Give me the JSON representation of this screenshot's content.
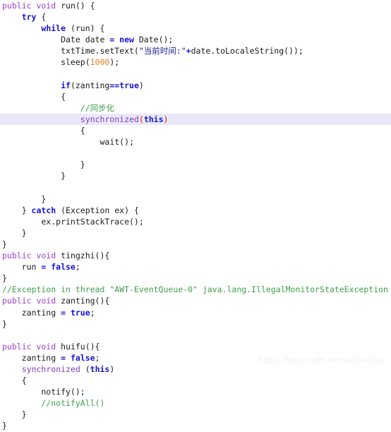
{
  "document": {
    "kind": "source-code-screenshot",
    "language": "Java",
    "watermark": "https://blog.csdn.net/xindashou"
  },
  "code": {
    "lines": [
      {
        "highlighted": false,
        "tokens": [
          {
            "t": "public void ",
            "c": "mod"
          },
          {
            "t": "run() {",
            "c": "plain"
          }
        ]
      },
      {
        "highlighted": false,
        "tokens": [
          {
            "t": "    ",
            "c": "plain"
          },
          {
            "t": "try",
            "c": "kw"
          },
          {
            "t": " {",
            "c": "plain"
          }
        ]
      },
      {
        "highlighted": false,
        "tokens": [
          {
            "t": "        ",
            "c": "plain"
          },
          {
            "t": "while",
            "c": "kw"
          },
          {
            "t": " (run) {",
            "c": "plain"
          }
        ]
      },
      {
        "highlighted": false,
        "tokens": [
          {
            "t": "            Date date ",
            "c": "plain"
          },
          {
            "t": "= new",
            "c": "kw"
          },
          {
            "t": " Date();",
            "c": "plain"
          }
        ]
      },
      {
        "highlighted": false,
        "tokens": [
          {
            "t": "            txtTime.setText(",
            "c": "plain"
          },
          {
            "t": "\"当前时间:\"",
            "c": "str"
          },
          {
            "t": "+",
            "c": "kw"
          },
          {
            "t": "date.toLocaleString());",
            "c": "plain"
          }
        ]
      },
      {
        "highlighted": false,
        "tokens": [
          {
            "t": "            sleep(",
            "c": "plain"
          },
          {
            "t": "1000",
            "c": "num"
          },
          {
            "t": ");",
            "c": "plain"
          }
        ]
      },
      {
        "highlighted": false,
        "tokens": [
          {
            "t": "",
            "c": "plain"
          }
        ]
      },
      {
        "highlighted": false,
        "tokens": [
          {
            "t": "            ",
            "c": "plain"
          },
          {
            "t": "if",
            "c": "kw"
          },
          {
            "t": "(zanting",
            "c": "plain"
          },
          {
            "t": "==true",
            "c": "kw"
          },
          {
            "t": ")",
            "c": "plain"
          }
        ]
      },
      {
        "highlighted": false,
        "tokens": [
          {
            "t": "            {",
            "c": "plain"
          }
        ]
      },
      {
        "highlighted": false,
        "tokens": [
          {
            "t": "                ",
            "c": "plain"
          },
          {
            "t": "//同步化",
            "c": "comment"
          }
        ]
      },
      {
        "highlighted": true,
        "tokens": [
          {
            "t": "                ",
            "c": "plain"
          },
          {
            "t": "synchronized",
            "c": "sync"
          },
          {
            "t": "(",
            "c": "paren-red"
          },
          {
            "t": "this",
            "c": "this"
          },
          {
            "t": ")",
            "c": "paren-red"
          }
        ]
      },
      {
        "highlighted": false,
        "tokens": [
          {
            "t": "                {",
            "c": "plain"
          }
        ]
      },
      {
        "highlighted": false,
        "tokens": [
          {
            "t": "                    wait();",
            "c": "plain"
          }
        ]
      },
      {
        "highlighted": false,
        "tokens": [
          {
            "t": "",
            "c": "plain"
          }
        ]
      },
      {
        "highlighted": false,
        "tokens": [
          {
            "t": "                }",
            "c": "plain"
          }
        ]
      },
      {
        "highlighted": false,
        "tokens": [
          {
            "t": "            }",
            "c": "plain"
          }
        ]
      },
      {
        "highlighted": false,
        "tokens": [
          {
            "t": "",
            "c": "plain"
          }
        ]
      },
      {
        "highlighted": false,
        "tokens": [
          {
            "t": "        }",
            "c": "plain"
          }
        ]
      },
      {
        "highlighted": false,
        "tokens": [
          {
            "t": "    } ",
            "c": "plain"
          },
          {
            "t": "catch",
            "c": "kw"
          },
          {
            "t": " (Exception ex) {",
            "c": "plain"
          }
        ]
      },
      {
        "highlighted": false,
        "tokens": [
          {
            "t": "        ex.printStackTrace();",
            "c": "plain"
          }
        ]
      },
      {
        "highlighted": false,
        "tokens": [
          {
            "t": "    }",
            "c": "plain"
          }
        ]
      },
      {
        "highlighted": false,
        "tokens": [
          {
            "t": "}",
            "c": "plain"
          }
        ]
      },
      {
        "highlighted": false,
        "tokens": [
          {
            "t": "public void ",
            "c": "mod"
          },
          {
            "t": "tingzhi(){",
            "c": "plain"
          }
        ]
      },
      {
        "highlighted": false,
        "tokens": [
          {
            "t": "    run ",
            "c": "plain"
          },
          {
            "t": "= false",
            "c": "kw"
          },
          {
            "t": ";",
            "c": "plain"
          }
        ]
      },
      {
        "highlighted": false,
        "tokens": [
          {
            "t": "}",
            "c": "plain"
          }
        ]
      },
      {
        "highlighted": false,
        "tokens": [
          {
            "t": "//Exception in thread \"AWT-EventQueue-0\" java.lang.IllegalMonitorStateException",
            "c": "comment"
          }
        ]
      },
      {
        "highlighted": false,
        "tokens": [
          {
            "t": "public void ",
            "c": "mod"
          },
          {
            "t": "zanting(){",
            "c": "plain"
          }
        ]
      },
      {
        "highlighted": false,
        "tokens": [
          {
            "t": "    zanting ",
            "c": "plain"
          },
          {
            "t": "= true",
            "c": "kw"
          },
          {
            "t": ";",
            "c": "plain"
          }
        ]
      },
      {
        "highlighted": false,
        "tokens": [
          {
            "t": "}",
            "c": "plain"
          }
        ]
      },
      {
        "highlighted": false,
        "tokens": [
          {
            "t": "",
            "c": "plain"
          }
        ]
      },
      {
        "highlighted": false,
        "tokens": [
          {
            "t": "public void ",
            "c": "mod"
          },
          {
            "t": "huifu(){",
            "c": "plain"
          }
        ]
      },
      {
        "highlighted": false,
        "tokens": [
          {
            "t": "    zanting ",
            "c": "plain"
          },
          {
            "t": "= false",
            "c": "kw"
          },
          {
            "t": ";",
            "c": "plain"
          }
        ]
      },
      {
        "highlighted": false,
        "tokens": [
          {
            "t": "    ",
            "c": "plain"
          },
          {
            "t": "synchronized",
            "c": "sync"
          },
          {
            "t": " (",
            "c": "plain"
          },
          {
            "t": "this",
            "c": "this"
          },
          {
            "t": ")",
            "c": "plain"
          }
        ]
      },
      {
        "highlighted": false,
        "tokens": [
          {
            "t": "    {",
            "c": "plain"
          }
        ]
      },
      {
        "highlighted": false,
        "tokens": [
          {
            "t": "        notify();",
            "c": "plain"
          }
        ]
      },
      {
        "highlighted": false,
        "tokens": [
          {
            "t": "        ",
            "c": "plain"
          },
          {
            "t": "//notifyAll()",
            "c": "comment"
          }
        ]
      },
      {
        "highlighted": false,
        "tokens": [
          {
            "t": "    }",
            "c": "plain"
          }
        ]
      },
      {
        "highlighted": false,
        "tokens": [
          {
            "t": "}",
            "c": "plain"
          }
        ]
      }
    ]
  },
  "colors": {
    "background": "#ffffff",
    "keyword": "#1414d2",
    "modifier": "#9a3ec8",
    "comment": "#3f9e4d",
    "number": "#e88020",
    "string": "#1a1a8c",
    "synchronized": "#7f3fbf",
    "error_paren": "#e01010",
    "highlight_row": "#e8e8f8",
    "watermark": "#f0f0f0"
  }
}
